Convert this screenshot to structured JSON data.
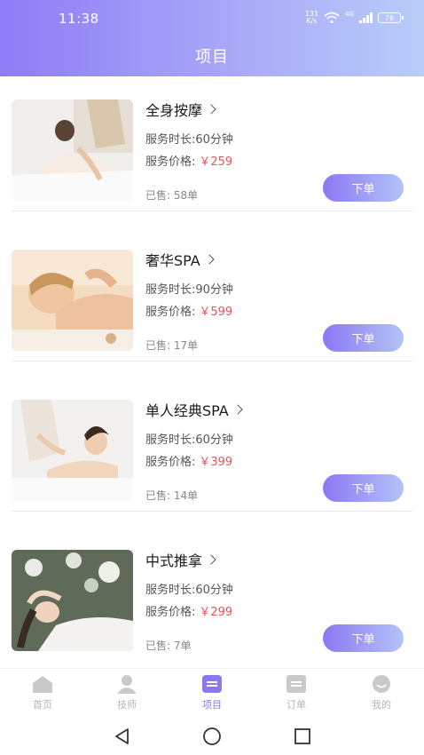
{
  "status_bar": {
    "time": "11:38",
    "speed_value": "131",
    "speed_unit": "K/s",
    "network": "4G",
    "battery": "76"
  },
  "page_title": "项目",
  "colors": {
    "accent": "#8a78f2",
    "price": "#e8545a",
    "header_start": "#8f7cf6",
    "header_end": "#b9cdf8"
  },
  "items": [
    {
      "name": "全身按摩",
      "duration_label": "服务时长:",
      "duration": "60分钟",
      "price_label": "服务价格:",
      "price": "￥259",
      "sold_label": "已售:",
      "sold": "58单",
      "order_label": "下单"
    },
    {
      "name": "奢华SPA",
      "duration_label": "服务时长:",
      "duration": "90分钟",
      "price_label": "服务价格:",
      "price": "￥599",
      "sold_label": "已售:",
      "sold": "17单",
      "order_label": "下单"
    },
    {
      "name": "单人经典SPA",
      "duration_label": "服务时长:",
      "duration": "60分钟",
      "price_label": "服务价格:",
      "price": "￥399",
      "sold_label": "已售:",
      "sold": "14单",
      "order_label": "下单"
    },
    {
      "name": "中式推拿",
      "duration_label": "服务时长:",
      "duration": "60分钟",
      "price_label": "服务价格:",
      "price": "￥299",
      "sold_label": "已售:",
      "sold": "7单",
      "order_label": "下单"
    }
  ],
  "tabs": [
    {
      "label": "首页",
      "icon": "home-icon"
    },
    {
      "label": "技师",
      "icon": "technician-icon"
    },
    {
      "label": "项目",
      "icon": "project-icon",
      "active": true
    },
    {
      "label": "订单",
      "icon": "order-icon"
    },
    {
      "label": "我的",
      "icon": "profile-icon"
    }
  ],
  "system_nav": [
    "back-icon",
    "home-circle-icon",
    "recents-icon"
  ]
}
